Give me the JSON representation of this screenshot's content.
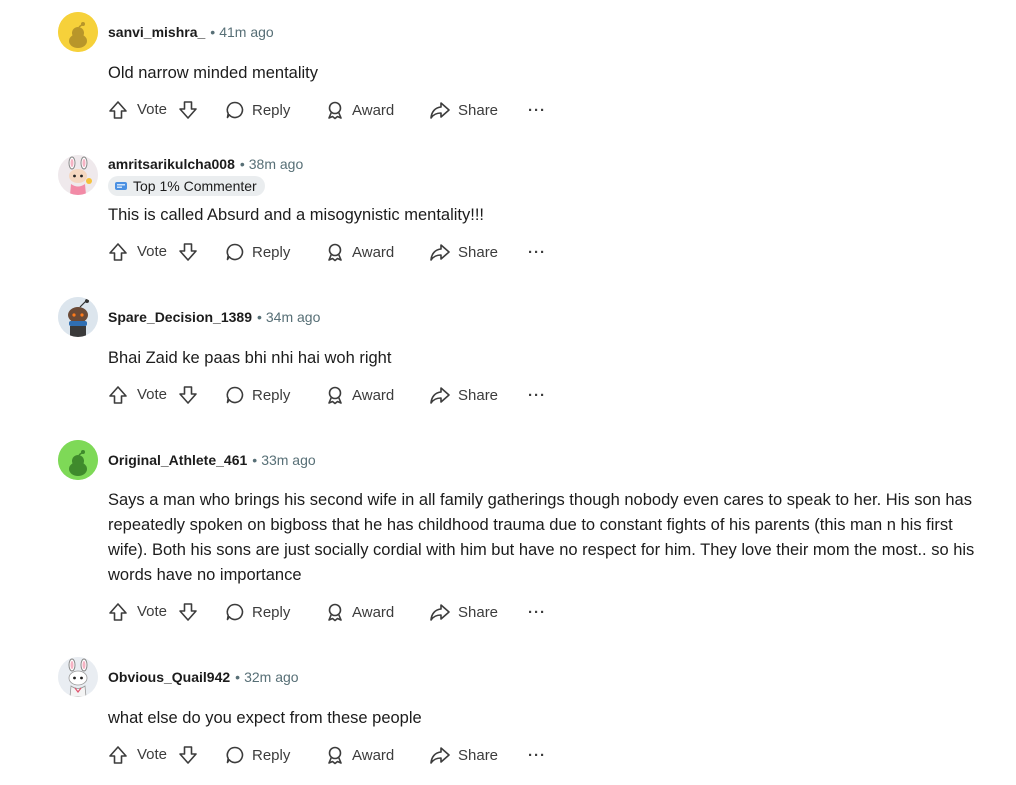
{
  "actions": {
    "vote": "Vote",
    "reply": "Reply",
    "award": "Award",
    "share": "Share",
    "more": "···"
  },
  "comments": [
    {
      "author": "sanvi_mishra_",
      "separator": "•",
      "time": "41m ago",
      "text": "Old narrow minded mentality",
      "avatar": "yellow-snoo-avatar"
    },
    {
      "author": "amritsarikulcha008",
      "separator": "•",
      "time": "38m ago",
      "badge": "Top 1% Commenter",
      "text": "This is called Absurd and a misogynistic mentality!!!",
      "avatar": "bunny-ears-avatar"
    },
    {
      "author": "Spare_Decision_1389",
      "separator": "•",
      "time": "34m ago",
      "text": "Bhai Zaid ke paas bhi nhi hai woh right",
      "avatar": "scarf-snoo-avatar"
    },
    {
      "author": "Original_Athlete_461",
      "separator": "•",
      "time": "33m ago",
      "text": "Says a man who brings his second wife in all family gatherings though nobody even cares to speak to her. His son has repeatedly spoken on bigboss that he has childhood trauma due to constant fights of his parents (this man n his first wife). Both his sons are just socially cordial with him but have no respect for him. They love their mom the most.. so his words have no importance",
      "avatar": "green-snoo-avatar"
    },
    {
      "author": "Obvious_Quail942",
      "separator": "•",
      "time": "32m ago",
      "text": "what else do you expect from these people",
      "avatar": "bunny-ears-avatar"
    }
  ],
  "colors": {
    "meta_gray": "#576f76",
    "badge_bg": "#eaedef",
    "yellow_avatar": "#f5d03b",
    "green_avatar": "#7ed957"
  }
}
